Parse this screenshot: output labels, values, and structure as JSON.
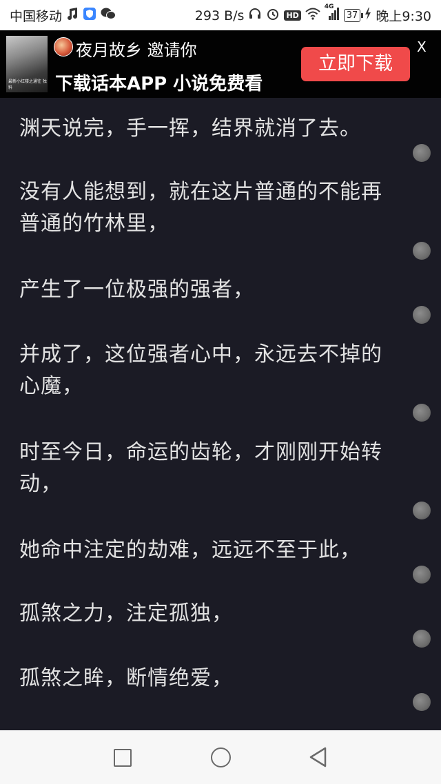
{
  "status_bar": {
    "carrier": "中国移动",
    "carrier_icons": [
      "music-note-icon",
      "shield-app-icon",
      "wechat-icon"
    ],
    "net_speed": "293 B/s",
    "hd_badge": "HD",
    "network_type": "4G",
    "battery": "37",
    "time": "晚上9:30"
  },
  "ad": {
    "thumb_caption": "最新小红楼之通往 独料",
    "inviter_line": "夜月故乡 邀请你",
    "headline": "下载话本APP 小说免费看",
    "download_button": "立即下载",
    "close_label": "X"
  },
  "content": {
    "paragraphs": [
      "渊天说完，手一挥，结界就消了去。",
      "没有人能想到，就在这片普通的不能再普通的竹林里，",
      "产生了一位极强的强者，",
      "并成了，这位强者心中，永远去不掉的心魔，",
      "时至今日，命运的齿轮，才刚刚开始转动，",
      "她命中注定的劫难，远远不至于此，",
      "孤煞之力，注定孤独，",
      "孤煞之眸，断情绝爱，"
    ]
  },
  "nav": {
    "icons": [
      "recent-apps-icon",
      "home-icon",
      "back-icon"
    ]
  }
}
